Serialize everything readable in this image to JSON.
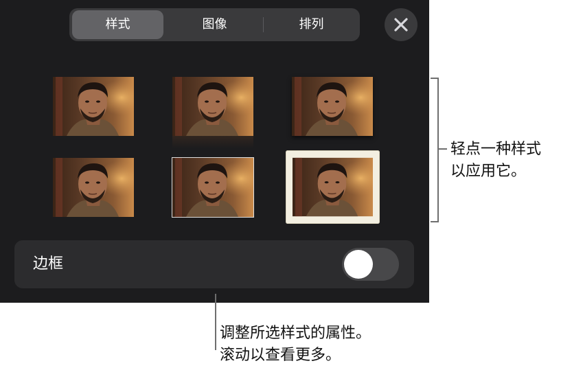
{
  "tabs": [
    {
      "label": "样式",
      "active": true
    },
    {
      "label": "图像",
      "active": false
    },
    {
      "label": "排列",
      "active": false
    }
  ],
  "close_icon": "close-icon",
  "styles": [
    {
      "name": "style-plain"
    },
    {
      "name": "style-reflection"
    },
    {
      "name": "style-shadow"
    },
    {
      "name": "style-thin-border"
    },
    {
      "name": "style-white-border"
    },
    {
      "name": "style-stamp-frame"
    }
  ],
  "border_row": {
    "label": "边框",
    "toggle_on": false
  },
  "callouts": {
    "right_line1": "轻点一种样式",
    "right_line2": "以应用它。",
    "bottom_line1": "调整所选样式的属性。",
    "bottom_line2": "滚动以查看更多。"
  },
  "colors": {
    "panel_bg": "#1c1c1e",
    "segment_bg": "#3a3a3c",
    "segment_active": "#636366",
    "toggle_off": "#48484a"
  }
}
